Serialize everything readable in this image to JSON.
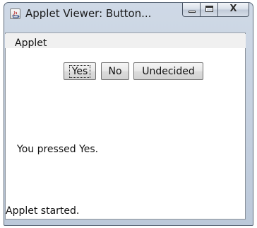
{
  "window": {
    "title": "Applet Viewer: Button...",
    "close_symbol": "X"
  },
  "menu": {
    "items": [
      {
        "label": "Applet"
      }
    ]
  },
  "applet": {
    "buttons": [
      {
        "label": "Yes",
        "focused": true
      },
      {
        "label": "No"
      },
      {
        "label": "Undecided"
      }
    ],
    "message": "You pressed Yes."
  },
  "status": {
    "text": "Applet started."
  },
  "icons": {
    "app": "java-applet-icon",
    "minimize": "minimize-icon",
    "maximize": "maximize-icon",
    "close": "close-icon"
  },
  "colors": {
    "titlebar": "#c6d2e1",
    "client_background": "#ffffff",
    "menubar": "#f0f0f0"
  }
}
